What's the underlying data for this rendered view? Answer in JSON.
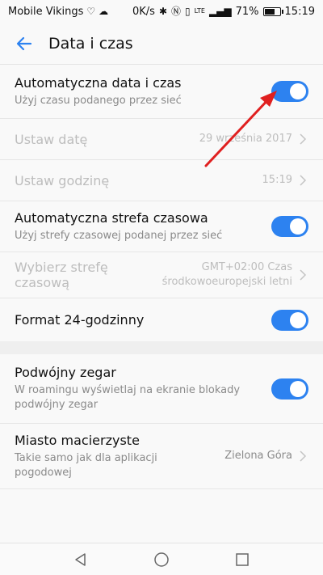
{
  "status": {
    "carrier": "Mobile Vikings",
    "speed": "0K/s",
    "network": "LTE",
    "battery": "71%",
    "battery_level": 0.71,
    "time": "15:19"
  },
  "header": {
    "title": "Data i czas"
  },
  "settings": {
    "auto_datetime": {
      "label": "Automatyczna data i czas",
      "sub": "Użyj czasu podanego przez sieć"
    },
    "set_date": {
      "label": "Ustaw datę",
      "value": "29 września 2017"
    },
    "set_time": {
      "label": "Ustaw godzinę",
      "value": "15:19"
    },
    "auto_timezone": {
      "label": "Automatyczna strefa czasowa",
      "sub": "Użyj strefy czasowej podanej przez sieć"
    },
    "choose_timezone": {
      "label": "Wybierz strefę czasową",
      "value_line1": "GMT+02:00 Czas",
      "value_line2": "środkowoeuropejski letni"
    },
    "format24": {
      "label": "Format 24-godzinny"
    },
    "dual_clock": {
      "label": "Podwójny zegar",
      "sub_line1": "W roamingu wyświetlaj na ekranie blokady",
      "sub_line2": "podwójny zegar"
    },
    "home_city": {
      "label": "Miasto macierzyste",
      "sub_line1": "Takie samo jak dla aplikacji",
      "sub_line2": "pogodowej",
      "value": "Zielona Góra"
    }
  },
  "colors": {
    "accent": "#2d82f0",
    "annotation_arrow": "#e02020"
  },
  "icons": {
    "back": "arrow-left-icon",
    "nav_back": "triangle-back-icon",
    "nav_home": "circle-home-icon",
    "nav_recent": "square-recent-icon"
  }
}
